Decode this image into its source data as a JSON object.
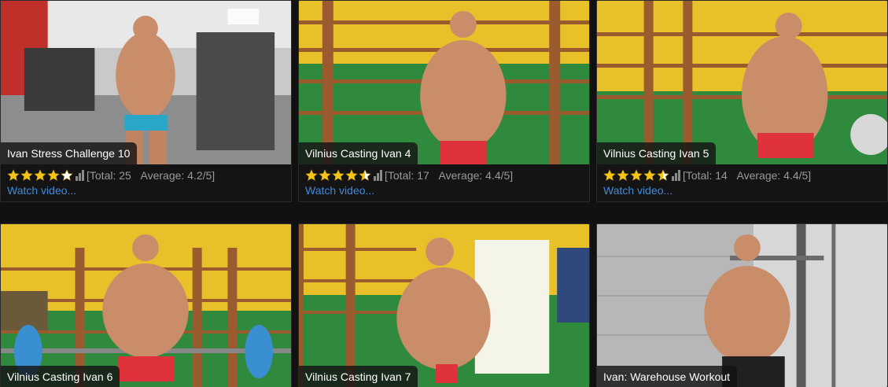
{
  "colors": {
    "link": "#3f8ad9",
    "star_gold": "#f5c518",
    "page_bg": "#111111"
  },
  "cards": [
    {
      "title": "Ivan Stress Challenge 10",
      "stars": 4,
      "rating_total": "[Total: 25",
      "rating_avg": "Average: 4.2/5]",
      "watch": "Watch video..."
    },
    {
      "title": "Vilnius Casting Ivan 4",
      "stars": 4.5,
      "rating_total": "[Total: 17",
      "rating_avg": "Average: 4.4/5]",
      "watch": "Watch video..."
    },
    {
      "title": "Vilnius Casting Ivan 5",
      "stars": 4.5,
      "rating_total": "[Total: 14",
      "rating_avg": "Average: 4.4/5]",
      "watch": "Watch video..."
    },
    {
      "title": "Vilnius Casting Ivan 6"
    },
    {
      "title": "Vilnius Casting Ivan 7"
    },
    {
      "title": "Ivan: Warehouse Workout"
    }
  ]
}
